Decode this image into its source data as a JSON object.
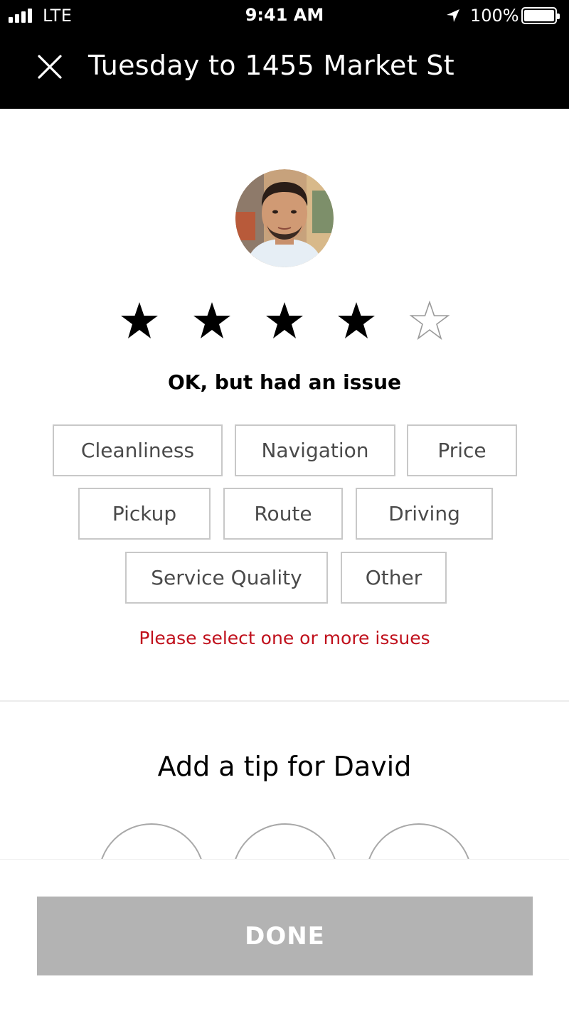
{
  "status_bar": {
    "carrier": "LTE",
    "time": "9:41 AM",
    "battery_percent": "100%"
  },
  "header": {
    "title": "Tuesday to 1455 Market St",
    "close_icon": "close-icon"
  },
  "rating": {
    "stars_total": 5,
    "stars_selected": 4,
    "label": "OK, but had an issue"
  },
  "issues": {
    "options": [
      "Cleanliness",
      "Navigation",
      "Price",
      "Pickup",
      "Route",
      "Driving",
      "Service Quality",
      "Other"
    ],
    "error": "Please select one or more issues"
  },
  "tip": {
    "title": "Add a tip for David"
  },
  "footer": {
    "done_label": "DONE"
  },
  "colors": {
    "header_bg": "#000000",
    "error": "#c0101c",
    "done_disabled": "#b3b3b3",
    "chip_border": "#c8c8c8"
  }
}
